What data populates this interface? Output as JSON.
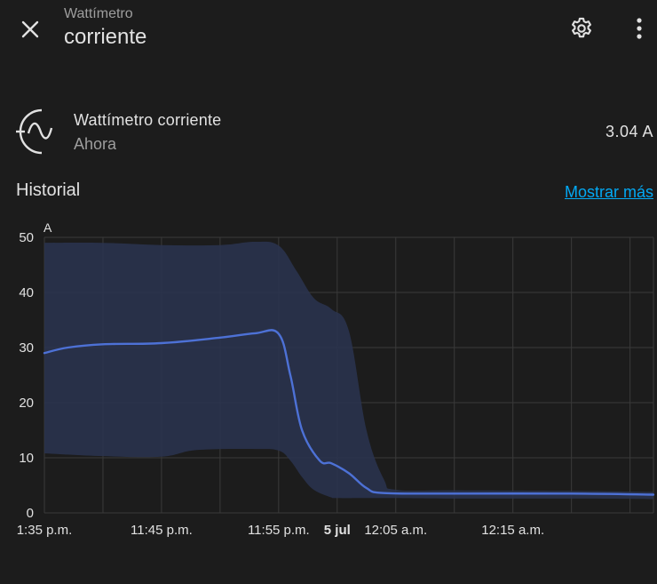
{
  "header": {
    "subtitle": "Wattímetro",
    "title": "corriente"
  },
  "entity": {
    "name": "Wattímetro corriente",
    "time": "Ahora",
    "state": "3.04 A",
    "icon": "sine-wave-icon"
  },
  "history": {
    "title": "Historial",
    "show_more": "Mostrar más"
  },
  "colors": {
    "background": "#1c1c1c",
    "line": "#4d71d6",
    "band": "#2a3450",
    "grid": "#3a3a3a",
    "link": "#03a9f4"
  },
  "chart_data": {
    "type": "line",
    "ylabel": "A",
    "ylim": [
      0,
      50
    ],
    "yticks": [
      "0",
      "10",
      "20",
      "30",
      "40",
      "50"
    ],
    "xlim_minutes": [
      0,
      52
    ],
    "xticks": [
      {
        "label": "1:35 p.m.",
        "minute": 0,
        "bold": false
      },
      {
        "label": "11:45 p.m.",
        "minute": 10,
        "bold": false
      },
      {
        "label": "11:55 p.m.",
        "minute": 20,
        "bold": false
      },
      {
        "label": "5 jul",
        "minute": 25,
        "bold": true
      },
      {
        "label": "12:05 a.m.",
        "minute": 30,
        "bold": false
      },
      {
        "label": "12:15 a.m.",
        "minute": 40,
        "bold": false
      }
    ],
    "series": [
      {
        "kind": "mean",
        "x": [
          0,
          2,
          5,
          10,
          15,
          18,
          20,
          21,
          22,
          23.5,
          24.5,
          26,
          27.5,
          29,
          35,
          45,
          52
        ],
        "values": [
          29,
          30,
          30.6,
          30.8,
          31.8,
          32.6,
          32.5,
          25,
          15,
          9.5,
          9,
          7.2,
          4.5,
          3.6,
          3.5,
          3.5,
          3.3
        ]
      },
      {
        "kind": "max",
        "x": [
          0,
          5,
          10,
          15,
          18,
          20,
          21.5,
          23,
          24.5,
          26,
          27.5,
          29,
          30,
          35,
          45,
          52
        ],
        "values": [
          49,
          49,
          48.6,
          48.6,
          49.2,
          48.5,
          44,
          39,
          37,
          33,
          15,
          6,
          4.2,
          4.1,
          4,
          3.8
        ]
      },
      {
        "kind": "min",
        "x": [
          0,
          5,
          10,
          13,
          18,
          20,
          21,
          22,
          23,
          24.5,
          25,
          29,
          35,
          45,
          52
        ],
        "values": [
          10.8,
          10.3,
          10.2,
          11.4,
          11.6,
          11.3,
          9.5,
          6.5,
          4.2,
          2.8,
          2.7,
          2.7,
          2.6,
          2.6,
          2.5
        ]
      }
    ]
  }
}
